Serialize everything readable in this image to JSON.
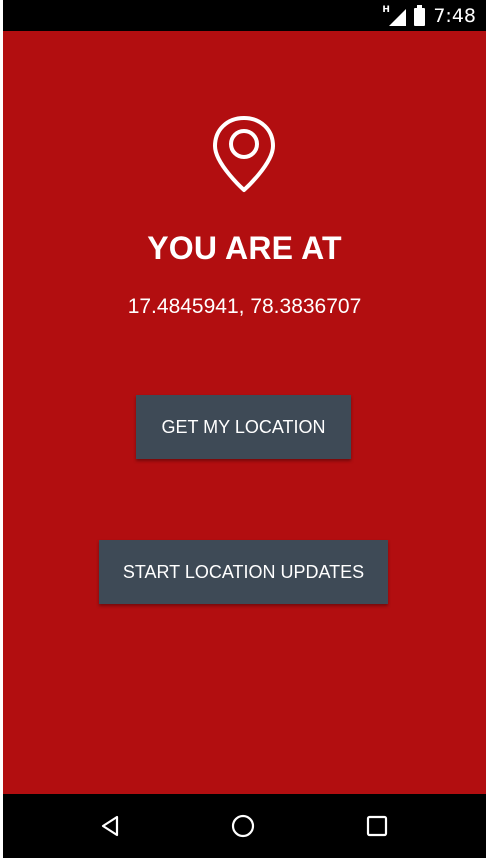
{
  "status_bar": {
    "network_type": "H",
    "time": "7:48",
    "icons": [
      "signal-icon",
      "battery-icon"
    ]
  },
  "app": {
    "background_color": "#b20e10",
    "icon": "location-pin-icon",
    "heading": "YOU ARE AT",
    "coordinates": "17.4845941, 78.3836707",
    "get_location_label": "GET MY LOCATION",
    "start_updates_label": "START LOCATION UPDATES",
    "button_color": "#3e4a56"
  },
  "nav_bar": {
    "icons": [
      "back-icon",
      "home-icon",
      "recent-apps-icon"
    ]
  }
}
